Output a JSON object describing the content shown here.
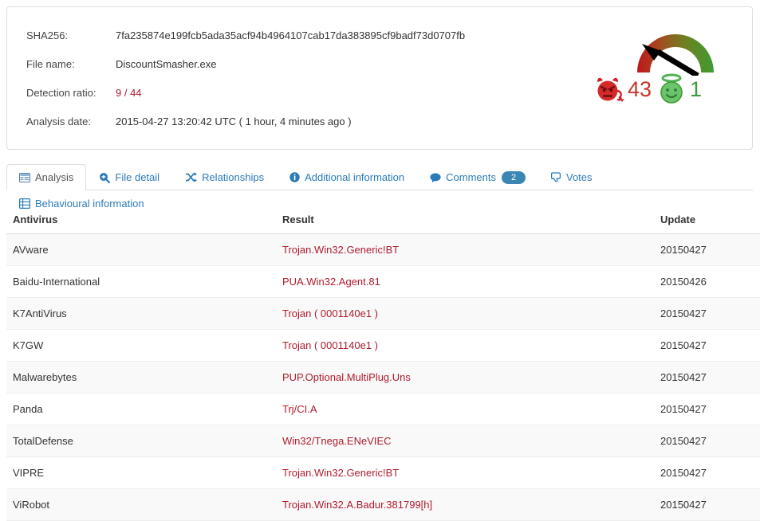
{
  "summary": {
    "fields": [
      {
        "label": "SHA256:",
        "value": "7fa235874e199fcb5ada35acf94b4964107cab17da383895cf9badf73d0707fb",
        "style": "plain"
      },
      {
        "label": "File name:",
        "value": "DiscountSmasher.exe",
        "style": "plain"
      },
      {
        "label": "Detection ratio:",
        "value": "9 / 44",
        "style": "ratio"
      },
      {
        "label": "Analysis date:",
        "value": "2015-04-27 13:20:42 UTC ( 1 hour, 4 minutes ago )",
        "style": "plain"
      }
    ]
  },
  "reputation": {
    "malicious_icon": "devil-face-icon",
    "malicious_count": "43",
    "harmless_icon": "angel-face-icon",
    "harmless_count": "1",
    "gauge_icon": "reputation-gauge-needle",
    "colors": {
      "bad": "#c0392b",
      "good": "#3c9a40",
      "arc_start": "#c0161c",
      "arc_mid": "#8a7a20",
      "arc_end": "#3f9c35"
    }
  },
  "tabs": [
    {
      "label": "Analysis",
      "icon": "list-table-icon",
      "active": true,
      "badge": null
    },
    {
      "label": "File detail",
      "icon": "magnifier-plus-icon",
      "active": false,
      "badge": null
    },
    {
      "label": "Relationships",
      "icon": "shuffle-arrows-icon",
      "active": false,
      "badge": null
    },
    {
      "label": "Additional information",
      "icon": "info-circle-icon",
      "active": false,
      "badge": null
    },
    {
      "label": "Comments",
      "icon": "speech-bubble-icon",
      "active": false,
      "badge": "2"
    },
    {
      "label": "Votes",
      "icon": "thumbs-down-icon",
      "active": false,
      "badge": null
    },
    {
      "label": "Behavioural information",
      "icon": "film-grid-icon",
      "active": false,
      "badge": null
    }
  ],
  "results_table": {
    "columns": [
      "Antivirus",
      "Result",
      "Update"
    ],
    "rows": [
      {
        "antivirus": "AVware",
        "result": "Trojan.Win32.Generic!BT",
        "update": "20150427"
      },
      {
        "antivirus": "Baidu-International",
        "result": "PUA.Win32.Agent.81",
        "update": "20150426"
      },
      {
        "antivirus": "K7AntiVirus",
        "result": "Trojan ( 0001140e1 )",
        "update": "20150427"
      },
      {
        "antivirus": "K7GW",
        "result": "Trojan ( 0001140e1 )",
        "update": "20150427"
      },
      {
        "antivirus": "Malwarebytes",
        "result": "PUP.Optional.MultiPlug.Uns",
        "update": "20150427"
      },
      {
        "antivirus": "Panda",
        "result": "Trj/CI.A",
        "update": "20150427"
      },
      {
        "antivirus": "TotalDefense",
        "result": "Win32/Tnega.ENeVIEC",
        "update": "20150427"
      },
      {
        "antivirus": "VIPRE",
        "result": "Trojan.Win32.Generic!BT",
        "update": "20150427"
      },
      {
        "antivirus": "ViRobot",
        "result": "Trojan.Win32.A.Badur.381799[h]",
        "update": "20150427"
      }
    ]
  }
}
